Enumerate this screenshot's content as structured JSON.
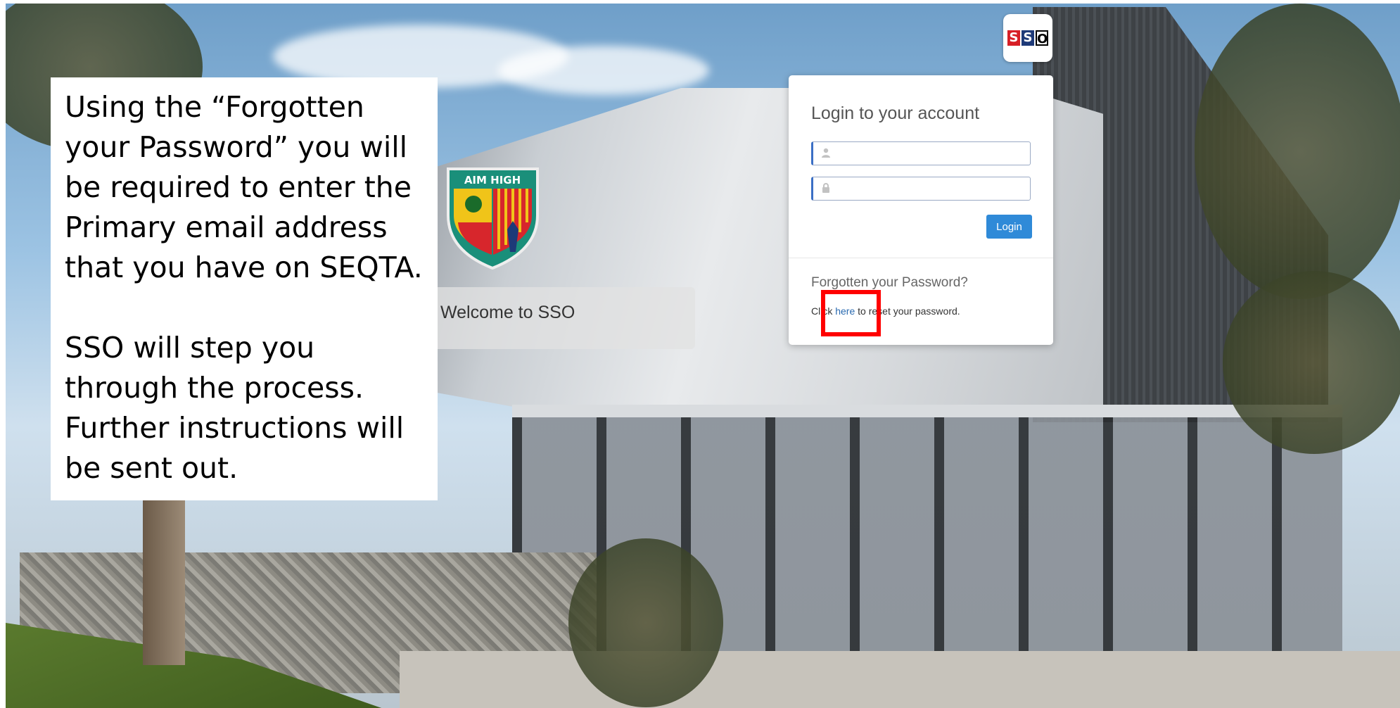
{
  "annotation": {
    "paragraph1": "Using the “Forgotten your Password” you will be required to enter the Primary email address that you have on SEQTA.",
    "paragraph2": "SSO will step you through the process.  Further instructions will be sent out."
  },
  "crest": {
    "motto": "AIM HIGH"
  },
  "welcome": {
    "text": "Welcome to SSO"
  },
  "sso_badge": {
    "letters": [
      "S",
      "S",
      "O"
    ]
  },
  "login": {
    "title": "Login to your account",
    "username_icon": "user-icon",
    "password_icon": "lock-icon",
    "username_value": "",
    "password_value": "",
    "login_button": "Login",
    "forgot_title": "Forgotten your Password?",
    "reset_prefix": "Click ",
    "reset_link": "here",
    "reset_suffix": " to reset your password."
  },
  "colors": {
    "accent_blue": "#2f8ad8",
    "highlight_red": "#ff0000"
  }
}
